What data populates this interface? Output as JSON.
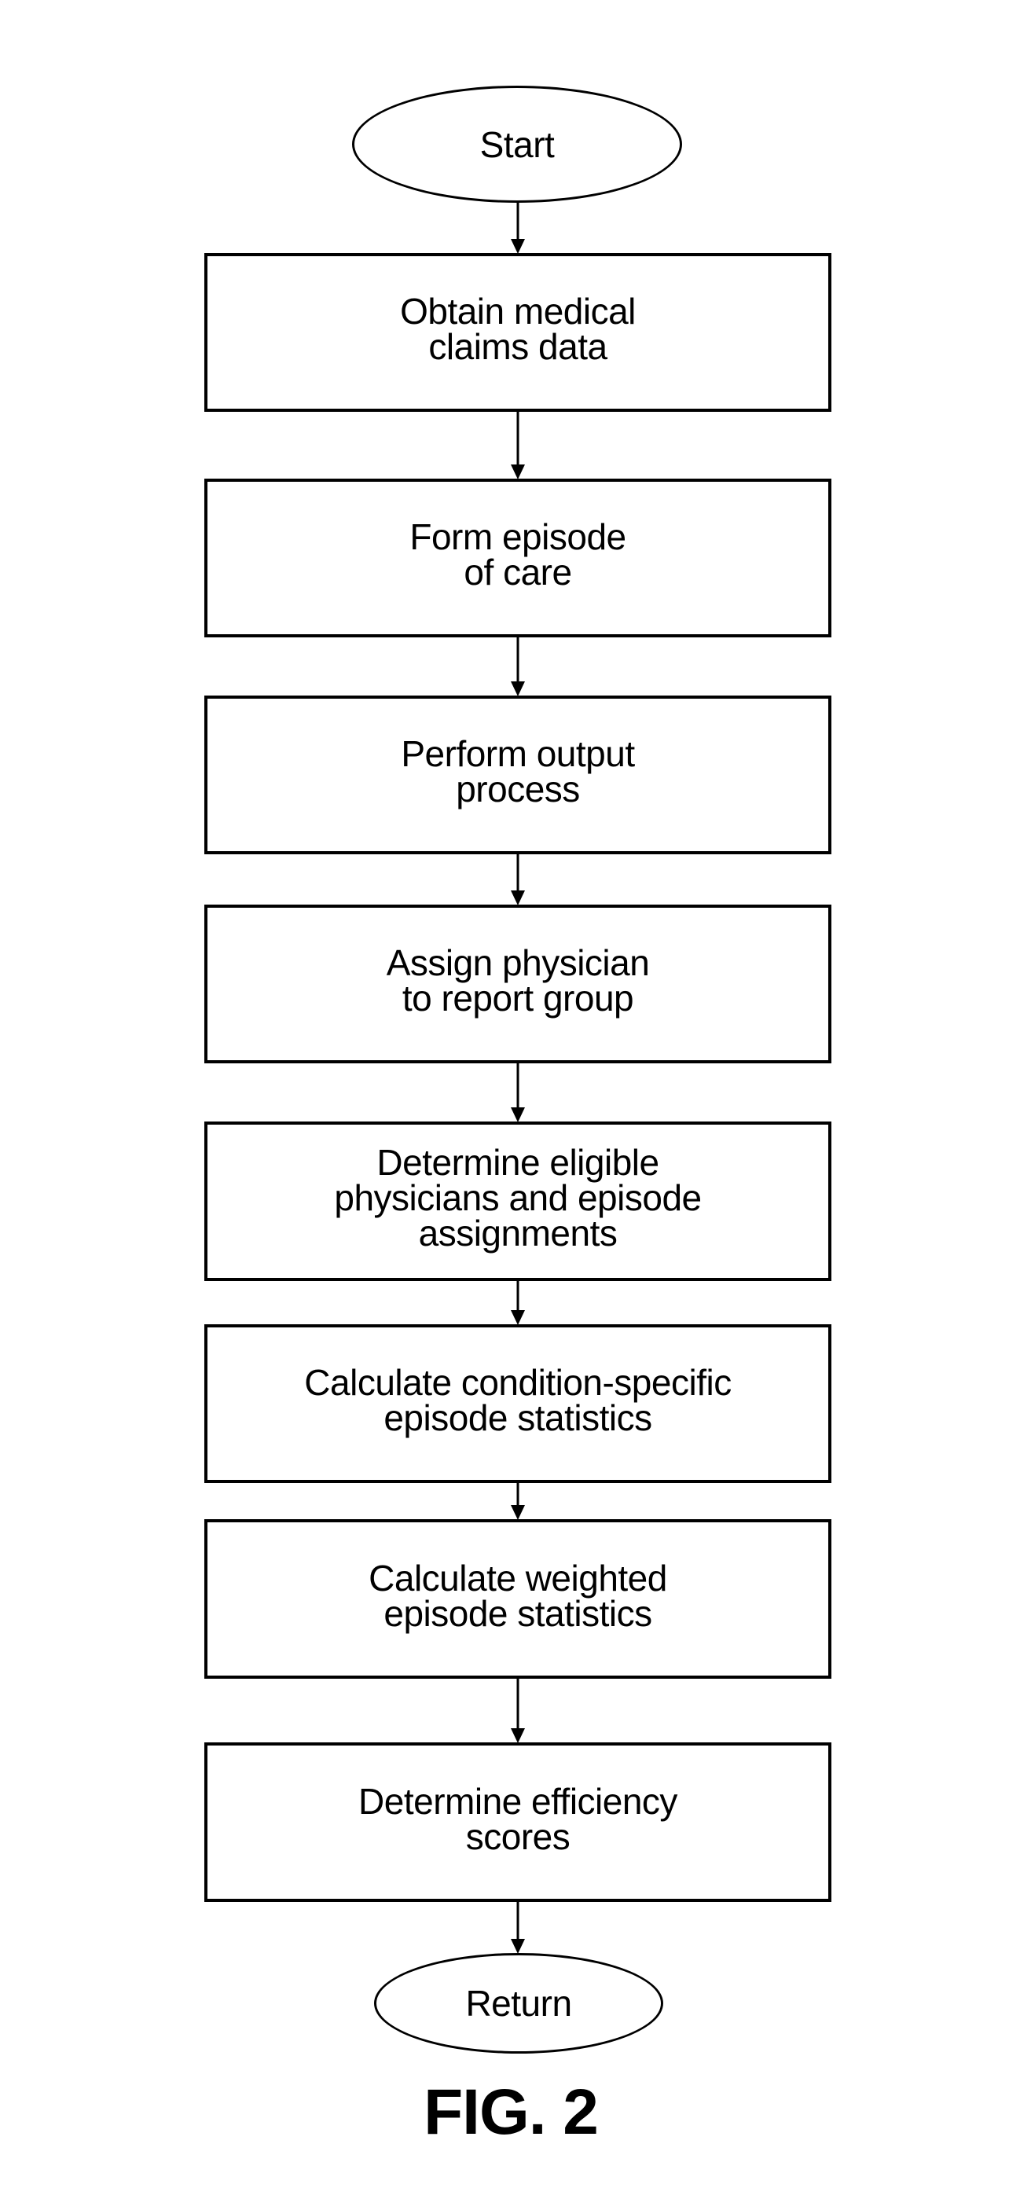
{
  "figure": {
    "label": "FIG. 2",
    "type": "flowchart"
  },
  "flowchart": {
    "start": {
      "label": "Start",
      "shape": "ellipse"
    },
    "steps": [
      {
        "label": "Obtain medical\nclaims data"
      },
      {
        "label": "Form episode\nof care"
      },
      {
        "label": "Perform output\nprocess"
      },
      {
        "label": "Assign physician\nto report group"
      },
      {
        "label": "Determine eligible\nphysicians and episode\nassignments"
      },
      {
        "label": "Calculate condition-specific\nepisode statistics"
      },
      {
        "label": "Calculate weighted\nepisode statistics"
      },
      {
        "label": "Determine efficiency\nscores"
      }
    ],
    "end": {
      "label": "Return",
      "shape": "ellipse"
    },
    "edges": [
      [
        "Start",
        "Obtain medical claims data"
      ],
      [
        "Obtain medical claims data",
        "Form episode of care"
      ],
      [
        "Form episode of care",
        "Perform output process"
      ],
      [
        "Perform output process",
        "Assign physician to report group"
      ],
      [
        "Assign physician to report group",
        "Determine eligible physicians and episode assignments"
      ],
      [
        "Determine eligible physicians and episode assignments",
        "Calculate condition-specific episode statistics"
      ],
      [
        "Calculate condition-specific episode statistics",
        "Calculate weighted episode statistics"
      ],
      [
        "Calculate weighted episode statistics",
        "Determine efficiency scores"
      ],
      [
        "Determine efficiency scores",
        "Return"
      ]
    ]
  },
  "colors": {
    "stroke": "#000000",
    "background": "#ffffff",
    "text": "#000000"
  }
}
